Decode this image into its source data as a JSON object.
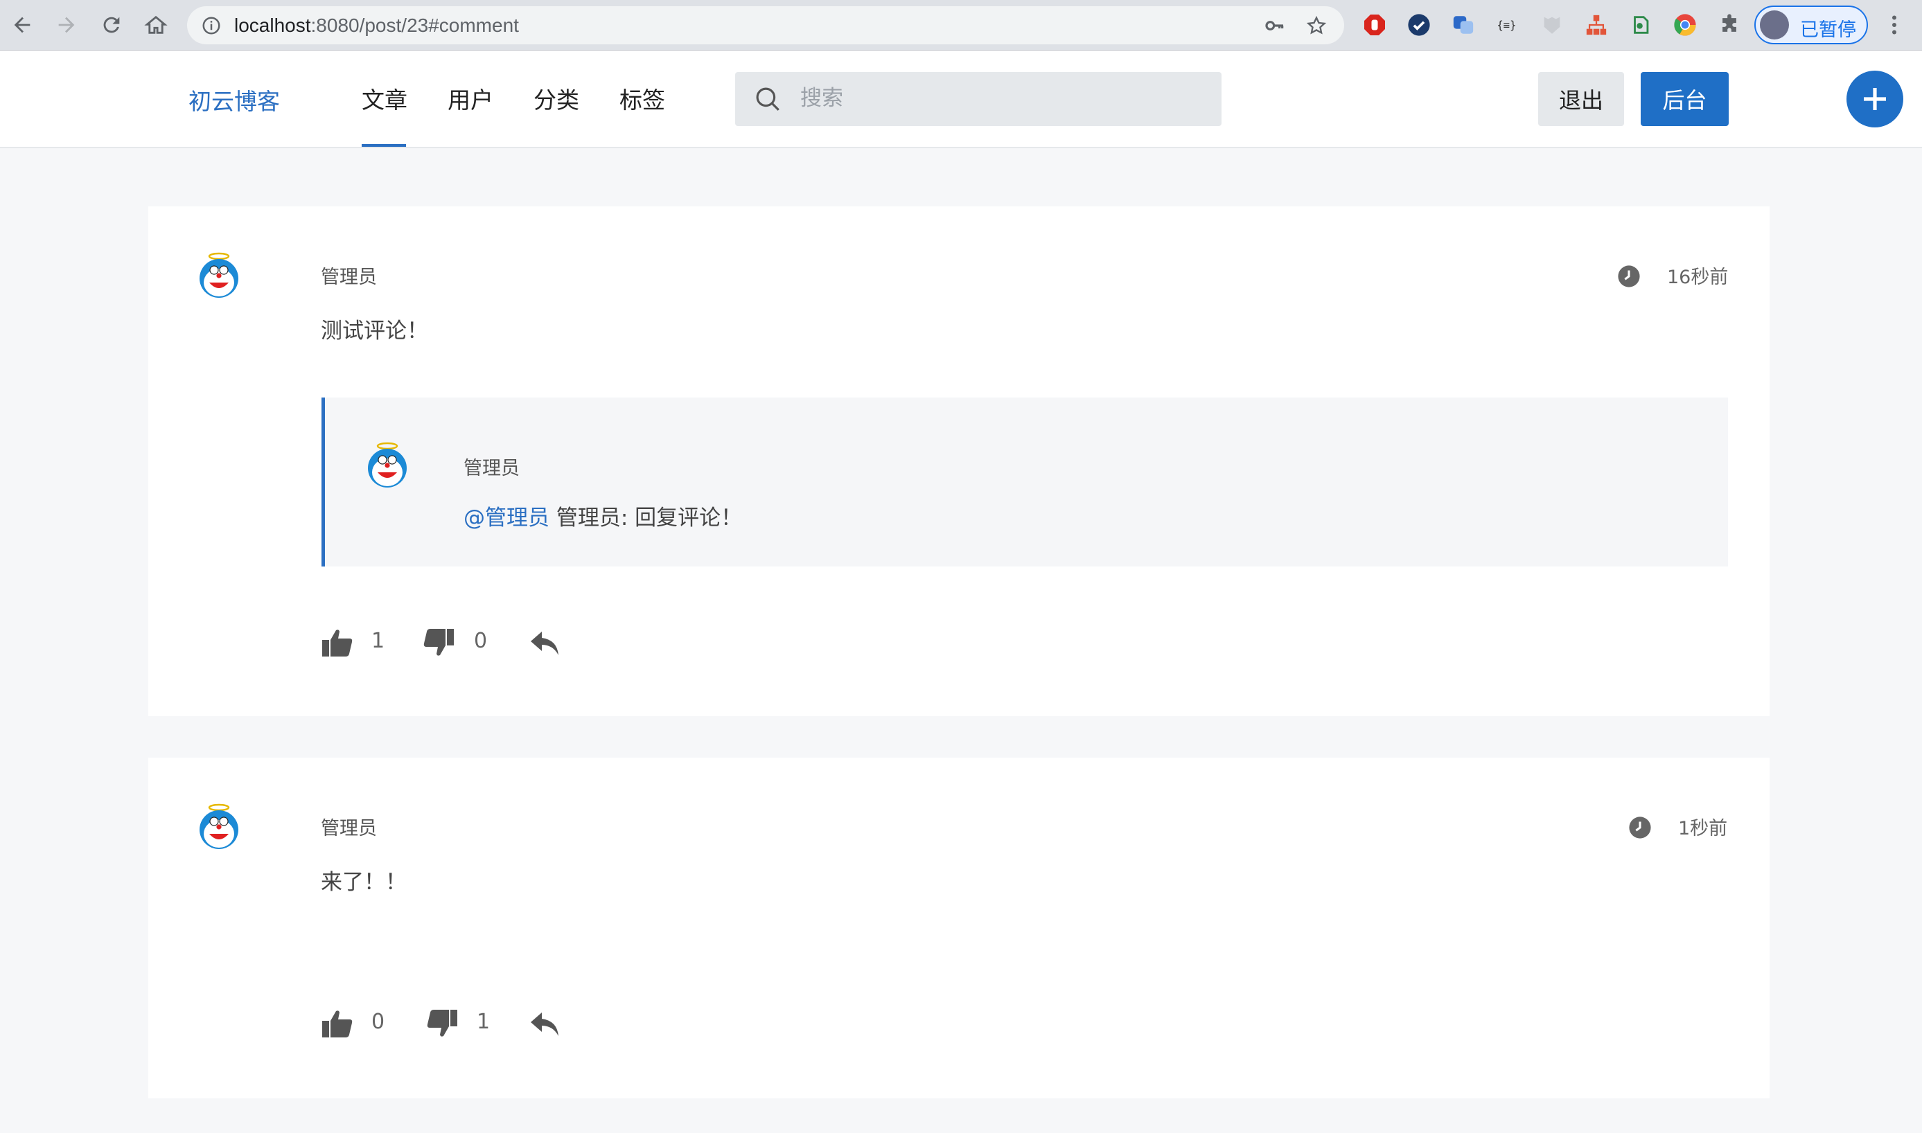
{
  "browser": {
    "url_host": "localhost",
    "url_rest": ":8080/post/23#comment",
    "profile_label": "已暂停"
  },
  "site": {
    "brand": "初云博客",
    "nav": [
      {
        "label": "文章",
        "active": true
      },
      {
        "label": "用户",
        "active": false
      },
      {
        "label": "分类",
        "active": false
      },
      {
        "label": "标签",
        "active": false
      }
    ],
    "search_placeholder": "搜索",
    "logout_label": "退出",
    "admin_label": "后台",
    "accent_color": "#1f6fc6"
  },
  "comments": [
    {
      "author": "管理员",
      "time": "16秒前",
      "content": "测试评论！",
      "reply": {
        "author": "管理员",
        "mention": "@管理员",
        "text": " 管理员: 回复评论！"
      },
      "likes": "1",
      "dislikes": "0"
    },
    {
      "author": "管理员",
      "time": "1秒前",
      "content": "来了！！",
      "likes": "0",
      "dislikes": "1"
    }
  ]
}
